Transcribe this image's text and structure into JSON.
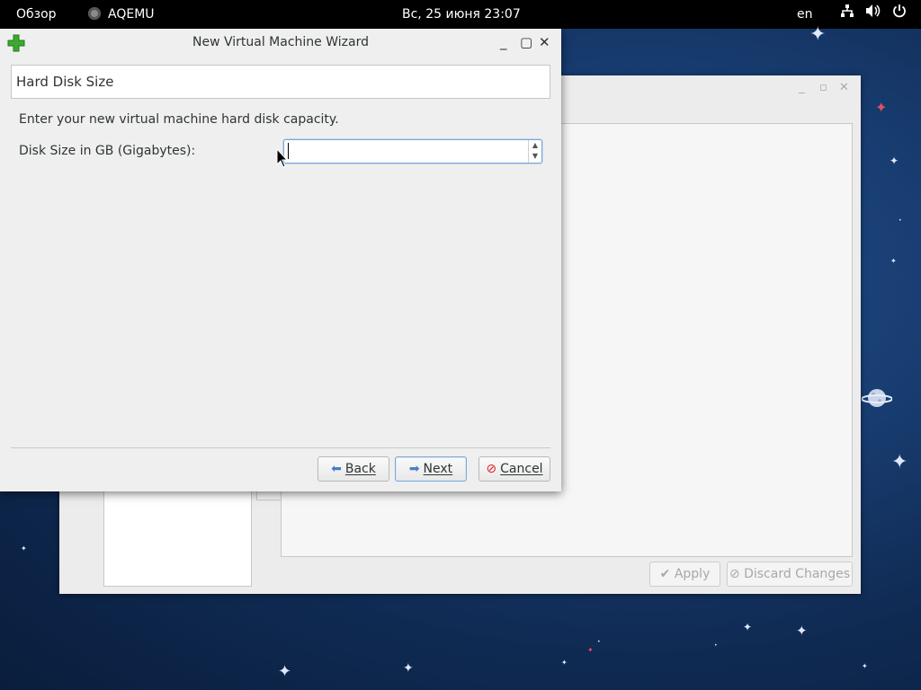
{
  "topbar": {
    "overview": "Обзор",
    "app_name": "AQEMU",
    "clock": "Вс, 25 июня  23:07",
    "lang": "en",
    "icons": [
      "network-icon",
      "volume-icon",
      "power-icon"
    ]
  },
  "background_window": {
    "apply_label": "Apply",
    "discard_label": "Discard Changes"
  },
  "dialog": {
    "title": "New Virtual Machine Wizard",
    "page_title": "Hard Disk Size",
    "description": "Enter your new virtual machine hard disk capacity.",
    "disk_size_label": "Disk Size in GB (Gigabytes):",
    "disk_size_value": "",
    "buttons": {
      "back": "Back",
      "next": "Next",
      "cancel": "Cancel"
    }
  },
  "colors": {
    "focus_border": "#7aa7d6",
    "cancel_icon": "#dd2222",
    "arrow_icon": "#4a7fc1"
  }
}
